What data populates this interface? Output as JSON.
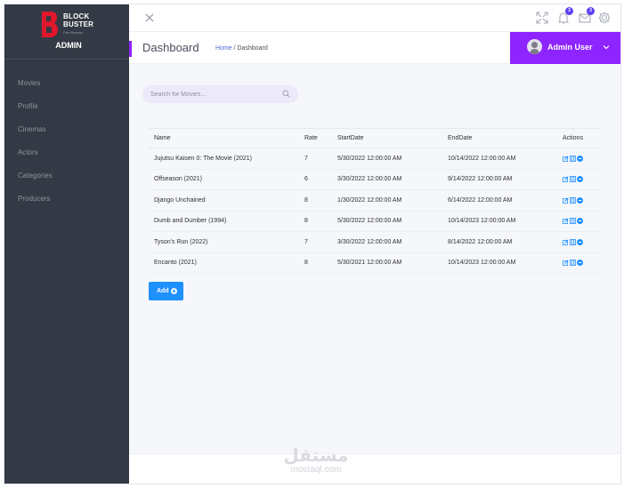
{
  "brand": {
    "logo_text": "BLOCK BUSTER",
    "logo_subtext": "Film Review",
    "admin_label": "ADMIN"
  },
  "sidebar": {
    "items": [
      {
        "label": "Movies"
      },
      {
        "label": "Profile"
      },
      {
        "label": "Cinemas"
      },
      {
        "label": "Actors"
      },
      {
        "label": "Categories"
      },
      {
        "label": "Producers"
      }
    ]
  },
  "topbar": {
    "icons": [
      "close-icon",
      "fullscreen-icon",
      "bell-icon",
      "mail-icon",
      "gear-icon"
    ],
    "notifications_count": "3",
    "messages_count": "3"
  },
  "header": {
    "title": "Dashboard",
    "breadcrumb_home": "Home",
    "breadcrumb_sep": " / ",
    "breadcrumb_current": "Dashboard",
    "user_name": "Admin User"
  },
  "search": {
    "placeholder": "Search for Movies..."
  },
  "table": {
    "headers": {
      "name": "Name",
      "rate": "Rate",
      "start": "StartDate",
      "end": "EndDate",
      "actions": "Actions"
    },
    "rows": [
      {
        "name": "Jujutsu Kaisen 0: The Movie (2021)",
        "rate": "7",
        "start": "5/30/2022 12:00:00 AM",
        "end": "10/14/2022 12:00:00 AM"
      },
      {
        "name": "Offseason (2021)",
        "rate": "6",
        "start": "3/30/2022 12:00:00 AM",
        "end": "9/14/2022 12:00:00 AM"
      },
      {
        "name": "Django Unchained",
        "rate": "8",
        "start": "1/30/2022 12:00:00 AM",
        "end": "6/14/2022 12:00:00 AM"
      },
      {
        "name": "Dumb and Dumber (1994)",
        "rate": "8",
        "start": "5/30/2022 12:00:00 AM",
        "end": "10/14/2023 12:00:00 AM"
      },
      {
        "name": "Tyson's Run (2022)",
        "rate": "7",
        "start": "3/30/2022 12:00:00 AM",
        "end": "8/14/2022 12:00:00 AM"
      },
      {
        "name": "Encanto (2021)",
        "rate": "8",
        "start": "5/30/2021 12:00:00 AM",
        "end": "10/14/2023 12:00:00 AM"
      }
    ]
  },
  "add_button": {
    "label": "Add"
  },
  "watermark": {
    "arabic": "مستقل",
    "latin": "mostaql.com"
  },
  "colors": {
    "accent": "#8e24ff",
    "sidebar": "#343a45",
    "primary_button": "#1e90ff",
    "brand_red": "#e0162b"
  }
}
